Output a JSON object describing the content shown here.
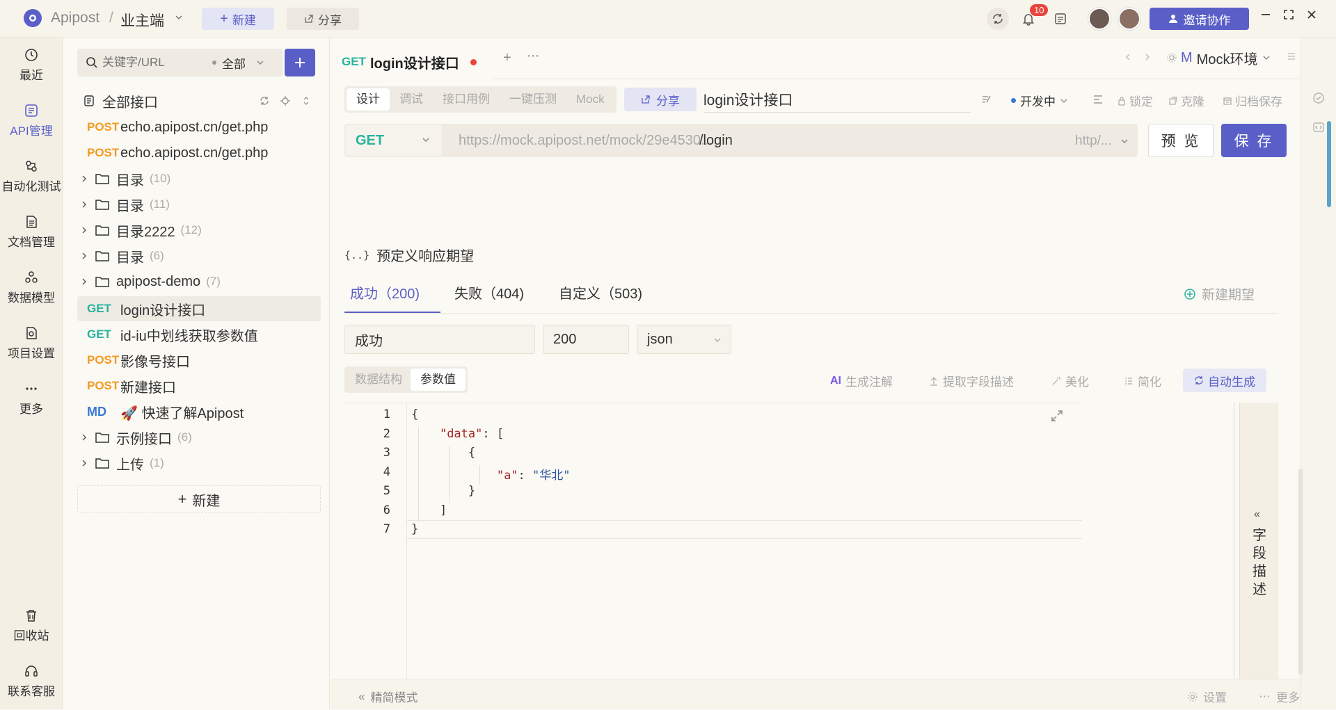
{
  "titlebar": {
    "app_name": "Apipost",
    "separator": "/",
    "workspace": "业主端",
    "new_label": "新建",
    "share_label": "分享",
    "notif_count": "10",
    "invite_label": "邀请协作"
  },
  "nav": {
    "items": [
      {
        "label": "最近",
        "icon": "clock-icon"
      },
      {
        "label": "API管理",
        "icon": "api-icon"
      },
      {
        "label": "自动化测试",
        "icon": "automation-icon"
      },
      {
        "label": "文档管理",
        "icon": "doc-icon"
      },
      {
        "label": "数据模型",
        "icon": "model-icon"
      },
      {
        "label": "项目设置",
        "icon": "settings-icon"
      },
      {
        "label": "更多",
        "icon": "more-icon"
      }
    ],
    "bottom": [
      {
        "label": "回收站",
        "icon": "trash-icon"
      },
      {
        "label": "联系客服",
        "icon": "headset-icon"
      }
    ]
  },
  "tree": {
    "search_placeholder": "关键字/URL",
    "filter": "全部",
    "root": "全部接口",
    "new_label": "新建",
    "items": [
      {
        "type": "api",
        "method": "POST",
        "name": "echo.apipost.cn/get.php"
      },
      {
        "type": "api",
        "method": "POST",
        "name": "echo.apipost.cn/get.php"
      },
      {
        "type": "folder",
        "name": "目录",
        "count": "(10)"
      },
      {
        "type": "folder",
        "name": "目录",
        "count": "(11)"
      },
      {
        "type": "folder",
        "name": "目录2222",
        "count": "(12)"
      },
      {
        "type": "folder",
        "name": "目录",
        "count": "(6)"
      },
      {
        "type": "folder",
        "name": "apipost-demo",
        "count": "(7)"
      },
      {
        "type": "api",
        "method": "GET",
        "name": "login设计接口",
        "selected": true
      },
      {
        "type": "api",
        "method": "GET",
        "name": "id-iu中划线获取参数值"
      },
      {
        "type": "api",
        "method": "POST",
        "name": "影像号接口"
      },
      {
        "type": "api",
        "method": "POST",
        "name": "新建接口"
      },
      {
        "type": "api",
        "method": "MD",
        "name": "🚀 快速了解Apipost"
      },
      {
        "type": "folder",
        "name": "示例接口",
        "count": "(6)"
      },
      {
        "type": "folder",
        "name": "上传",
        "count": "(1)"
      }
    ]
  },
  "tab": {
    "method": "GET",
    "title": "login设计接口",
    "env": "Mock环境",
    "env_badge": "M"
  },
  "subtabs": [
    "设计",
    "调试",
    "接口用例",
    "一键压测",
    "Mock"
  ],
  "share_label": "分享",
  "api_name": "login设计接口",
  "status": "开发中",
  "actions": [
    "锁定",
    "克隆",
    "归档保存"
  ],
  "request": {
    "method": "GET",
    "base_url": "https://mock.apipost.net/mock/29e4530...",
    "path": "/login",
    "protocol": "http/...",
    "preview_label": "预 览",
    "save_label": "保 存"
  },
  "mock": {
    "section_title": "预定义响应期望",
    "tabs": [
      "成功（200)",
      "失败（404)",
      "自定义（503)"
    ],
    "new_expect": "新建期望",
    "name": "成功",
    "code": "200",
    "format": "json",
    "view_tabs": [
      "数据结构",
      "参数值"
    ],
    "tools": [
      "生成注解",
      "提取字段描述",
      "美化",
      "简化",
      "自动生成"
    ],
    "side_label": "字段描述"
  },
  "code_lines": [
    {
      "n": "1",
      "text": "{"
    },
    {
      "n": "2",
      "text": "    \"data\": ["
    },
    {
      "n": "3",
      "text": "        {"
    },
    {
      "n": "4",
      "text": "            \"a\": \"华北\""
    },
    {
      "n": "5",
      "text": "        }"
    },
    {
      "n": "6",
      "text": "    ]"
    },
    {
      "n": "7",
      "text": "}"
    }
  ],
  "footer": {
    "simple_mode": "精简模式",
    "settings": "设置",
    "more": "更多"
  },
  "colors": {
    "accent": "#5a5fc8",
    "get": "#27b39e",
    "post": "#f29a24",
    "md": "#3a78d8"
  }
}
